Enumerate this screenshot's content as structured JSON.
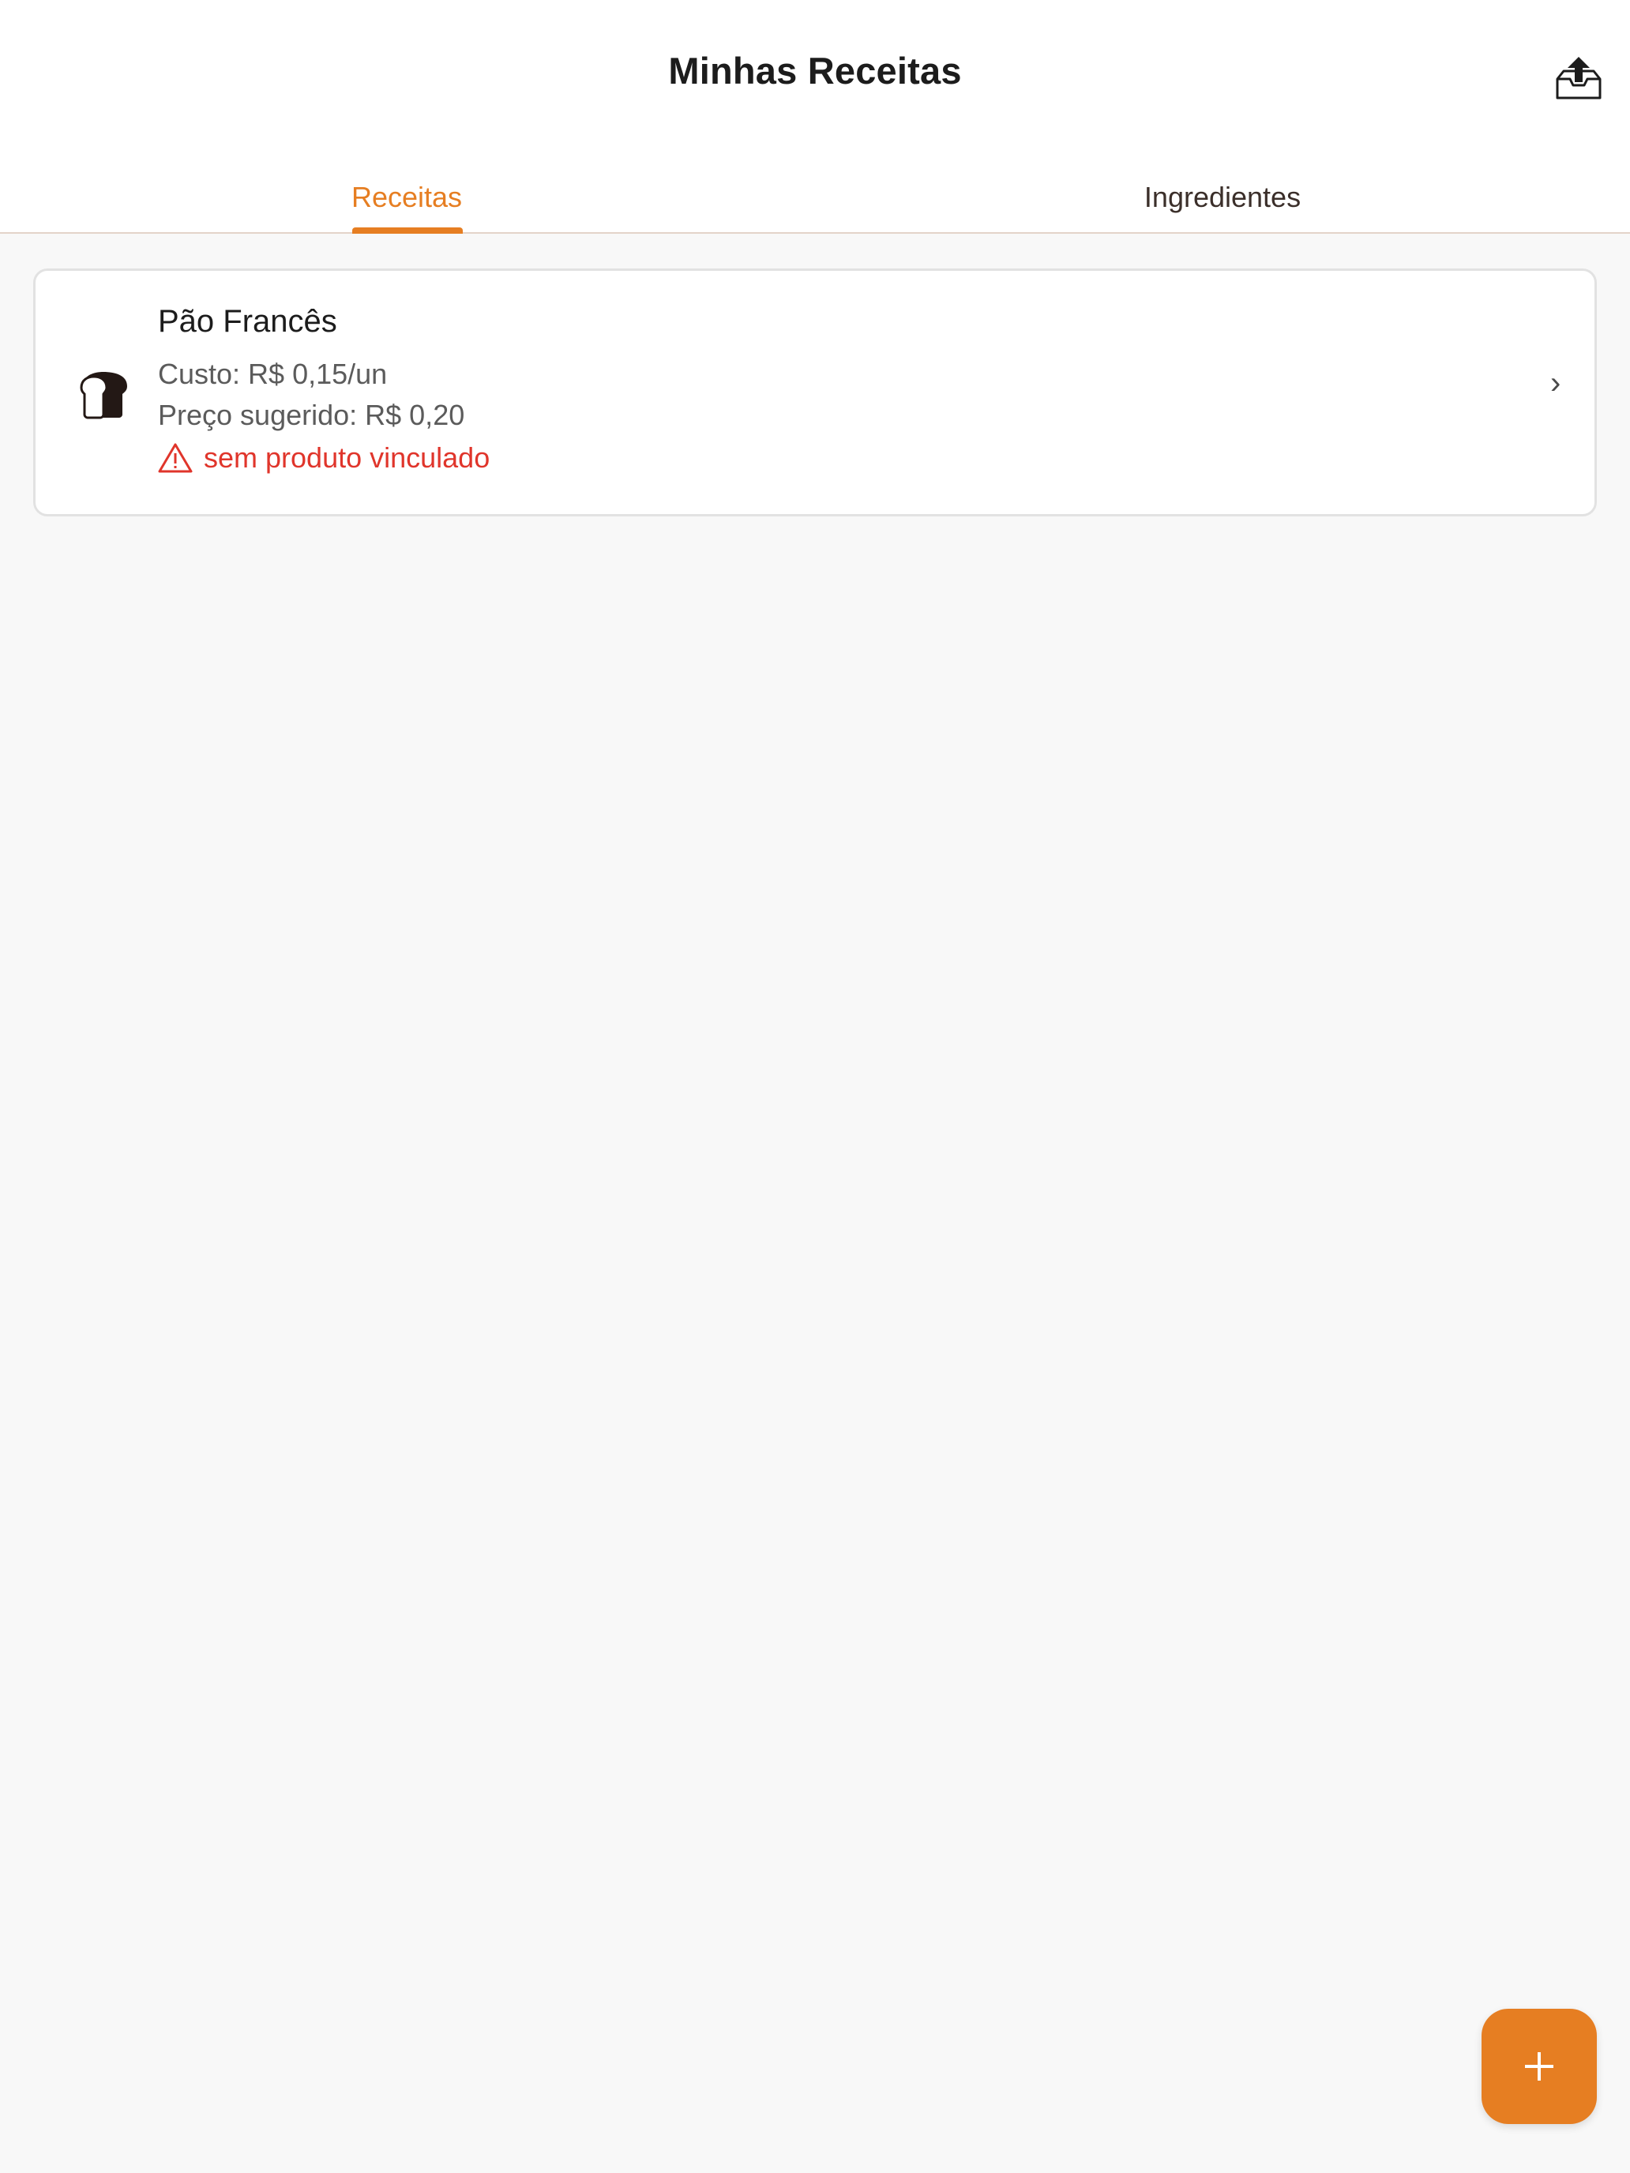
{
  "header": {
    "title": "Minhas Receitas",
    "share_icon": "share-upload-icon"
  },
  "tabs": [
    {
      "label": "Receitas",
      "active": true
    },
    {
      "label": "Ingredientes",
      "active": false
    }
  ],
  "recipes": [
    {
      "name": "Pão Francês",
      "icon": "bread-icon",
      "cost": "Custo: R$ 0,15/un",
      "suggested_price": "Preço sugerido: R$ 0,20",
      "warning": "sem produto vinculado",
      "warning_icon": "warning-icon",
      "chevron": "›"
    }
  ],
  "fab": {
    "icon": "plus-icon"
  },
  "colors": {
    "accent": "#e67e22",
    "warning": "#e0352b",
    "background": "#f8f8f8"
  }
}
